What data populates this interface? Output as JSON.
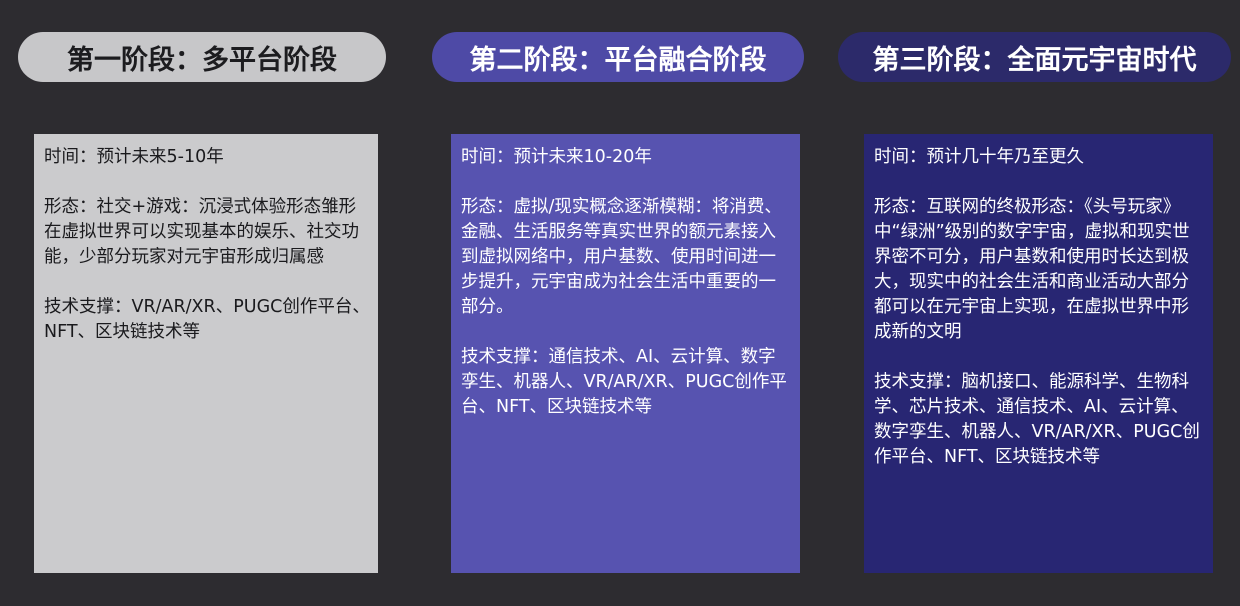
{
  "stages": [
    {
      "title": "第一阶段：多平台阶段",
      "time": "时间：预计未来5-10年",
      "form": "形态：社交+游戏：沉浸式体验形态雏形在虚拟世界可以实现基本的娱乐、社交功能，少部分玩家对元宇宙形成归属感",
      "tech": "技术支撑：VR/AR/XR、PUGC创作平台、NFT、区块链技术等"
    },
    {
      "title": "第二阶段：平台融合阶段",
      "time": "时间：预计未来10-20年",
      "form": "形态：虚拟/现实概念逐渐模糊：将消费、金融、生活服务等真实世界的额元素接入到虚拟网络中，用户基数、使用时间进一步提升，元宇宙成为社会生活中重要的一部分。",
      "tech": "技术支撑：通信技术、AI、云计算、数字孪生、机器人、VR/AR/XR、PUGC创作平台、NFT、区块链技术等"
    },
    {
      "title": "第三阶段：全面元宇宙时代",
      "time": "时间：预计几十年乃至更久",
      "form": "形态：互联网的终极形态：《头号玩家》中“绿洲”级别的数字宇宙，虚拟和现实世界密不可分，用户基数和使用时长达到极大，现实中的社会生活和商业活动大部分都可以在元宇宙上实现，在虚拟世界中形成新的文明",
      "tech": "技术支撑：脑机接口、能源科学、生物科学、芯片技术、通信技术、AI、云计算、数字孪生、机器人、VR/AR/XR、PUGC创作平台、NFT、区块链技术等"
    }
  ],
  "colors": {
    "background": "#2d2c30",
    "stage1_pill": "#c7c7c9",
    "stage1_card": "#cbcbcd",
    "stage2_pill": "#4e4aa6",
    "stage2_card": "#5753b0",
    "stage3_pill": "#2c2a6a",
    "stage3_card": "#282673"
  }
}
